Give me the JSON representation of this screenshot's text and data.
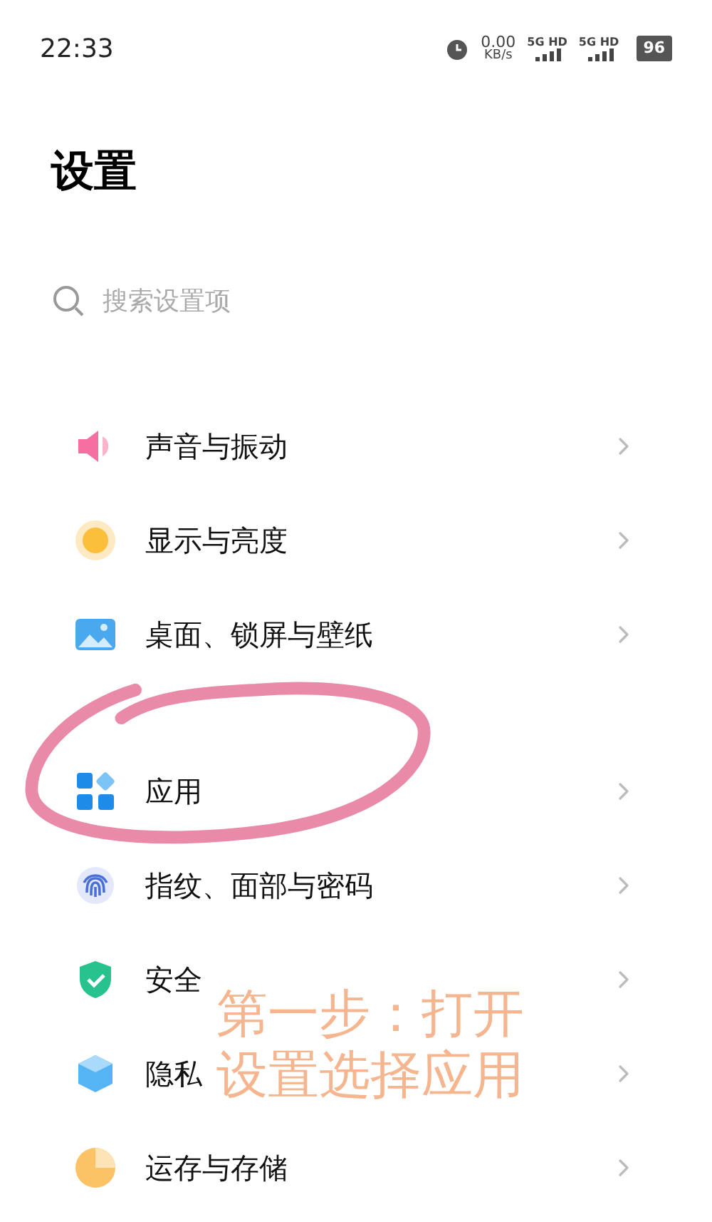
{
  "status_bar": {
    "time": "22:33",
    "speed": "0.00",
    "speed_unit": "KB/s",
    "sim_1": "5G HD",
    "sim_2": "5G HD",
    "battery": "96"
  },
  "title": "设置",
  "search": {
    "placeholder": "搜索设置项"
  },
  "sections": [
    {
      "items": [
        {
          "kind": "sound",
          "label": "声音与振动"
        },
        {
          "kind": "display",
          "label": "显示与亮度"
        },
        {
          "kind": "wallpaper",
          "label": "桌面、锁屏与壁纸"
        }
      ]
    },
    {
      "items": [
        {
          "kind": "apps",
          "label": "应用"
        },
        {
          "kind": "fingerprint",
          "label": "指纹、面部与密码"
        },
        {
          "kind": "security",
          "label": "安全"
        },
        {
          "kind": "privacy",
          "label": "隐私"
        },
        {
          "kind": "storage",
          "label": "运存与存储"
        }
      ]
    }
  ],
  "annotation": {
    "lines": [
      "第一步：打开",
      "设置选择应用"
    ]
  }
}
